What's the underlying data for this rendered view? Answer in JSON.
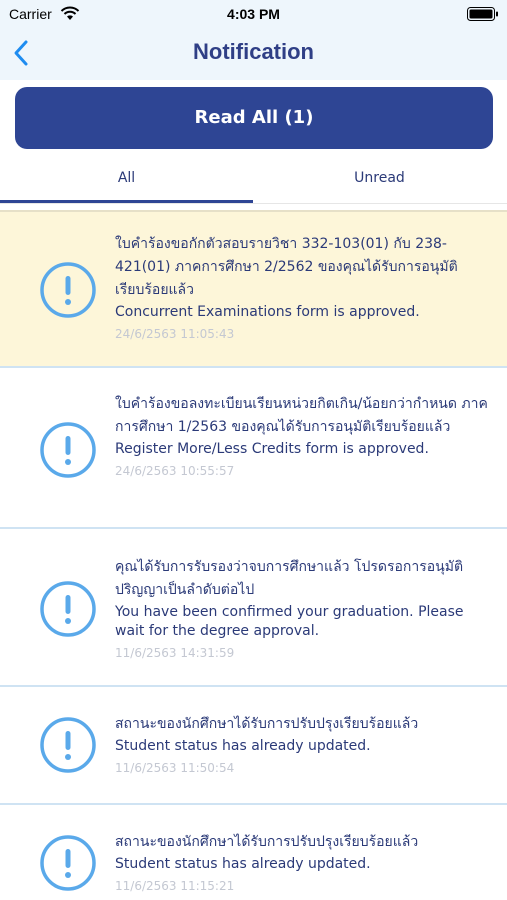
{
  "status_bar": {
    "carrier": "Carrier",
    "time": "4:03 PM",
    "wifi_icon": "wifi-icon",
    "battery_icon": "battery-icon"
  },
  "nav": {
    "title": "Notification",
    "back_icon": "chevron-left-icon"
  },
  "read_all_label": "Read All (1)",
  "tabs": [
    {
      "label": "All",
      "selected": true
    },
    {
      "label": "Unread",
      "selected": false
    }
  ],
  "colors": {
    "primary": "#2e4594",
    "unread_bg": "#fdf6d9",
    "icon": "#5aa9ea",
    "date": "#c4c8d2"
  },
  "notifications": [
    {
      "thai": "ใบคำร้องขอกักตัวสอบรายวิชา 332-103(01) กับ 238-421(01) ภาคการศึกษา 2/2562 ของคุณได้รับการอนุมัติเรียบร้อยแล้ว",
      "english": "Concurrent Examinations form is approved.",
      "date": "24/6/2563 11:05:43",
      "unread": true
    },
    {
      "thai": "ใบคำร้องขอลงทะเบียนเรียนหน่วยกิตเกิน/น้อยกว่ากำหนด ภาคการศึกษา 1/2563 ของคุณได้รับการอนุมัติเรียบร้อยแล้ว",
      "english": "Register More/Less Credits form is approved.",
      "date": "24/6/2563 10:55:57",
      "unread": false
    },
    {
      "thai": "คุณได้รับการรับรองว่าจบการศึกษาแล้ว โปรดรอการอนุมัติปริญญาเป็นลำดับต่อไป",
      "english": "You have been confirmed your graduation. Please wait for the degree approval.",
      "date": "11/6/2563 14:31:59",
      "unread": false
    },
    {
      "thai": "สถานะของนักศึกษาได้รับการปรับปรุงเรียบร้อยแล้ว",
      "english": "Student status has already updated.",
      "date": "11/6/2563 11:50:54",
      "unread": false
    },
    {
      "thai": "สถานะของนักศึกษาได้รับการปรับปรุงเรียบร้อยแล้ว",
      "english": "Student status has already updated.",
      "date": "11/6/2563 11:15:21",
      "unread": false
    }
  ]
}
